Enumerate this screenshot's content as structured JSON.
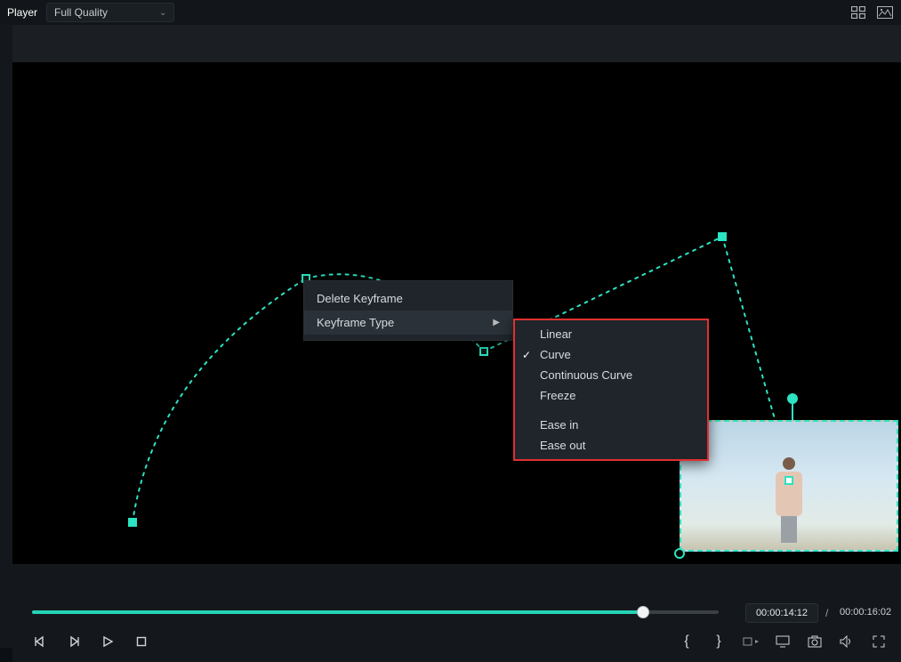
{
  "topbar": {
    "player_label": "Player",
    "quality_selected": "Full Quality"
  },
  "context_menu": {
    "items": [
      {
        "label": "Delete Keyframe",
        "has_sub": false
      },
      {
        "label": "Keyframe Type",
        "has_sub": true,
        "hover": true
      }
    ]
  },
  "submenu": {
    "items": [
      {
        "label": "Linear",
        "checked": false
      },
      {
        "label": "Curve",
        "checked": true
      },
      {
        "label": "Continuous Curve",
        "checked": false
      },
      {
        "label": "Freeze",
        "checked": false
      }
    ],
    "items2": [
      {
        "label": "Ease in"
      },
      {
        "label": "Ease out"
      }
    ]
  },
  "timeline": {
    "current": "00:00:14:12",
    "total": "00:00:16:02",
    "progress_pct": 89
  },
  "icons": {
    "brace_open": "{",
    "brace_close": "}",
    "separator": "/"
  }
}
